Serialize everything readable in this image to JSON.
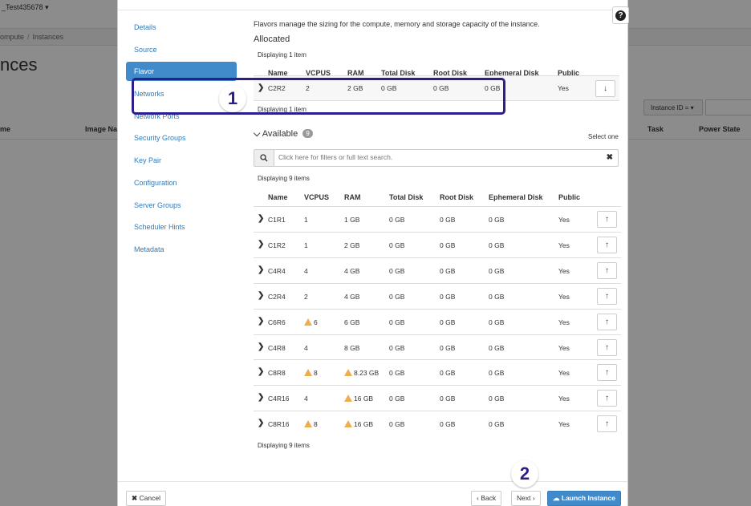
{
  "background": {
    "project": "_Test435678",
    "breadcrumb": [
      "ompute",
      "Instances"
    ],
    "title": "nces",
    "filter_label": "Instance ID = ",
    "headers": [
      "me",
      "Image Na",
      "Task",
      "Power State"
    ]
  },
  "modal": {
    "help": "?",
    "nav": [
      "Details",
      "Source",
      "Flavor",
      "Networks",
      "Network Ports",
      "Security Groups",
      "Key Pair",
      "Configuration",
      "Server Groups",
      "Scheduler Hints",
      "Metadata"
    ],
    "active_nav": "Flavor",
    "intro": "Flavors manage the sizing for the compute, memory and storage capacity of the instance.",
    "allocated": {
      "title": "Allocated",
      "displaying_top": "Displaying 1 item",
      "displaying_bottom": "Displaying 1 item",
      "columns": [
        "Name",
        "VCPUS",
        "RAM",
        "Total Disk",
        "Root Disk",
        "Ephemeral Disk",
        "Public"
      ],
      "row": {
        "name": "C2R2",
        "vcpus": "2",
        "ram": "2 GB",
        "total": "0 GB",
        "root": "0 GB",
        "eph": "0 GB",
        "public": "Yes"
      }
    },
    "available": {
      "title": "Available",
      "count": "9",
      "select_hint": "Select one",
      "search_placeholder": "Click here for filters or full text search.",
      "displaying_top": "Displaying 9 items",
      "displaying_bottom": "Displaying 9 items",
      "columns": [
        "Name",
        "VCPUS",
        "RAM",
        "Total Disk",
        "Root Disk",
        "Ephemeral Disk",
        "Public"
      ],
      "rows": [
        {
          "name": "C1R1",
          "vcpus": "1",
          "vwarn": false,
          "ram": "1 GB",
          "rwarn": false,
          "total": "0 GB",
          "root": "0 GB",
          "eph": "0 GB",
          "public": "Yes"
        },
        {
          "name": "C1R2",
          "vcpus": "1",
          "vwarn": false,
          "ram": "2 GB",
          "rwarn": false,
          "total": "0 GB",
          "root": "0 GB",
          "eph": "0 GB",
          "public": "Yes"
        },
        {
          "name": "C4R4",
          "vcpus": "4",
          "vwarn": false,
          "ram": "4 GB",
          "rwarn": false,
          "total": "0 GB",
          "root": "0 GB",
          "eph": "0 GB",
          "public": "Yes"
        },
        {
          "name": "C2R4",
          "vcpus": "2",
          "vwarn": false,
          "ram": "4 GB",
          "rwarn": false,
          "total": "0 GB",
          "root": "0 GB",
          "eph": "0 GB",
          "public": "Yes"
        },
        {
          "name": "C6R6",
          "vcpus": "6",
          "vwarn": true,
          "ram": "6 GB",
          "rwarn": false,
          "total": "0 GB",
          "root": "0 GB",
          "eph": "0 GB",
          "public": "Yes"
        },
        {
          "name": "C4R8",
          "vcpus": "4",
          "vwarn": false,
          "ram": "8 GB",
          "rwarn": false,
          "total": "0 GB",
          "root": "0 GB",
          "eph": "0 GB",
          "public": "Yes"
        },
        {
          "name": "C8R8",
          "vcpus": "8",
          "vwarn": true,
          "ram": "8.23 GB",
          "rwarn": true,
          "total": "0 GB",
          "root": "0 GB",
          "eph": "0 GB",
          "public": "Yes"
        },
        {
          "name": "C4R16",
          "vcpus": "4",
          "vwarn": false,
          "ram": "16 GB",
          "rwarn": true,
          "total": "0 GB",
          "root": "0 GB",
          "eph": "0 GB",
          "public": "Yes"
        },
        {
          "name": "C8R16",
          "vcpus": "8",
          "vwarn": true,
          "ram": "16 GB",
          "rwarn": true,
          "total": "0 GB",
          "root": "0 GB",
          "eph": "0 GB",
          "public": "Yes"
        }
      ]
    },
    "footer": {
      "cancel": "Cancel",
      "back": "Back",
      "next": "Next",
      "launch": "Launch Instance"
    },
    "callouts": {
      "one": "1",
      "two": "2"
    },
    "colors": {
      "accent": "#428bca",
      "callout": "#2b1f8c",
      "warning": "#f0ad4e"
    }
  }
}
